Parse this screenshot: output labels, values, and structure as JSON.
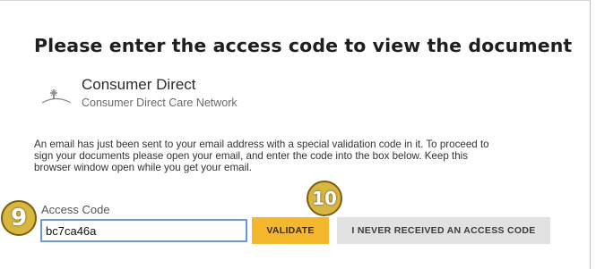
{
  "page_title": "Please enter the access code to view the document",
  "brand": {
    "logo_icon": "consumer-direct-logo-icon",
    "name": "Consumer Direct",
    "subtitle": "Consumer Direct Care Network"
  },
  "message": {
    "line1": "An email has just been sent to your email address with a special validation code in it. To proceed to",
    "line2": "sign your documents please open your email, and enter the code into the box below. Keep this",
    "line3": "browser window open while you get your email."
  },
  "access_code": {
    "label": "Access Code",
    "value": "bc7ca46a"
  },
  "buttons": {
    "validate": "VALIDATE",
    "never_received": "I NEVER RECEIVED AN ACCESS CODE"
  },
  "annotations": {
    "step_a": "9",
    "step_b": "10"
  },
  "colors": {
    "validate_button": "#f5b82c",
    "secondary_button": "#e2e2e2",
    "input_focus_border": "#6d95d9",
    "annotation_badge": "#d8b642"
  }
}
